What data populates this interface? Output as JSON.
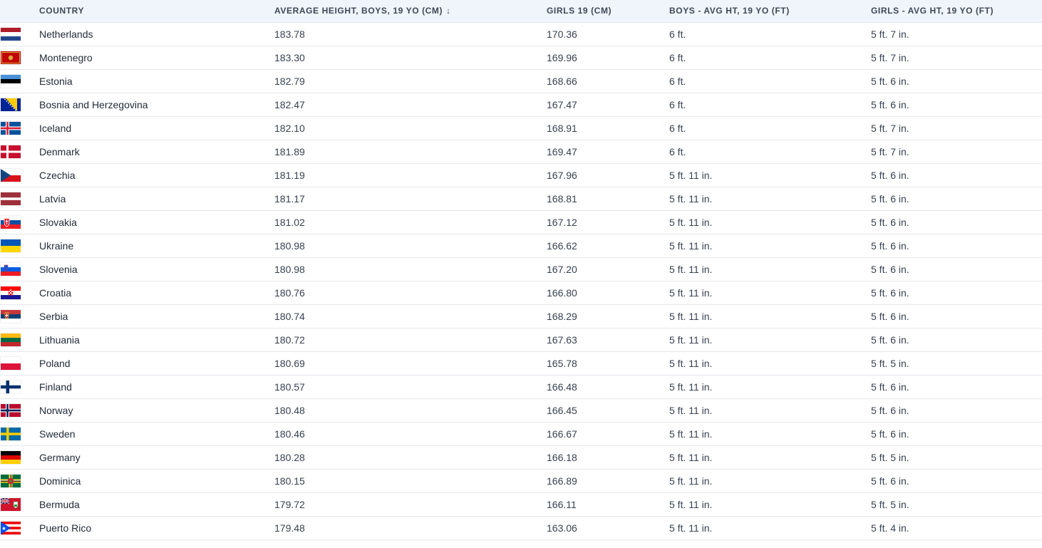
{
  "table": {
    "headers": {
      "country": "COUNTRY",
      "boys_cm": "AVERAGE HEIGHT, BOYS, 19 YO (CM)",
      "boys_cm_sort": "↓",
      "girls_cm": "GIRLS 19 (CM)",
      "boys_ft": "BOYS - AVG HT, 19 YO (FT)",
      "girls_ft": "GIRLS - AVG HT, 19 YO (FT)"
    },
    "rows": [
      {
        "flag": "netherlands-flag-icon",
        "country": "Netherlands",
        "boys_cm": "183.78",
        "girls_cm": "170.36",
        "boys_ft": "6 ft.",
        "girls_ft": "5 ft. 7 in."
      },
      {
        "flag": "montenegro-flag-icon",
        "country": "Montenegro",
        "boys_cm": "183.30",
        "girls_cm": "169.96",
        "boys_ft": "6 ft.",
        "girls_ft": "5 ft. 7 in."
      },
      {
        "flag": "estonia-flag-icon",
        "country": "Estonia",
        "boys_cm": "182.79",
        "girls_cm": "168.66",
        "boys_ft": "6 ft.",
        "girls_ft": "5 ft. 6 in."
      },
      {
        "flag": "bosnia-and-herzegovina-flag-icon",
        "country": "Bosnia and Herzegovina",
        "boys_cm": "182.47",
        "girls_cm": "167.47",
        "boys_ft": "6 ft.",
        "girls_ft": "5 ft. 6 in."
      },
      {
        "flag": "iceland-flag-icon",
        "country": "Iceland",
        "boys_cm": "182.10",
        "girls_cm": "168.91",
        "boys_ft": "6 ft.",
        "girls_ft": "5 ft. 7 in."
      },
      {
        "flag": "denmark-flag-icon",
        "country": "Denmark",
        "boys_cm": "181.89",
        "girls_cm": "169.47",
        "boys_ft": "6 ft.",
        "girls_ft": "5 ft. 7 in."
      },
      {
        "flag": "czechia-flag-icon",
        "country": "Czechia",
        "boys_cm": "181.19",
        "girls_cm": "167.96",
        "boys_ft": "5 ft. 11 in.",
        "girls_ft": "5 ft. 6 in."
      },
      {
        "flag": "latvia-flag-icon",
        "country": "Latvia",
        "boys_cm": "181.17",
        "girls_cm": "168.81",
        "boys_ft": "5 ft. 11 in.",
        "girls_ft": "5 ft. 6 in."
      },
      {
        "flag": "slovakia-flag-icon",
        "country": "Slovakia",
        "boys_cm": "181.02",
        "girls_cm": "167.12",
        "boys_ft": "5 ft. 11 in.",
        "girls_ft": "5 ft. 6 in."
      },
      {
        "flag": "ukraine-flag-icon",
        "country": "Ukraine",
        "boys_cm": "180.98",
        "girls_cm": "166.62",
        "boys_ft": "5 ft. 11 in.",
        "girls_ft": "5 ft. 6 in."
      },
      {
        "flag": "slovenia-flag-icon",
        "country": "Slovenia",
        "boys_cm": "180.98",
        "girls_cm": "167.20",
        "boys_ft": "5 ft. 11 in.",
        "girls_ft": "5 ft. 6 in."
      },
      {
        "flag": "croatia-flag-icon",
        "country": "Croatia",
        "boys_cm": "180.76",
        "girls_cm": "166.80",
        "boys_ft": "5 ft. 11 in.",
        "girls_ft": "5 ft. 6 in."
      },
      {
        "flag": "serbia-flag-icon",
        "country": "Serbia",
        "boys_cm": "180.74",
        "girls_cm": "168.29",
        "boys_ft": "5 ft. 11 in.",
        "girls_ft": "5 ft. 6 in."
      },
      {
        "flag": "lithuania-flag-icon",
        "country": "Lithuania",
        "boys_cm": "180.72",
        "girls_cm": "167.63",
        "boys_ft": "5 ft. 11 in.",
        "girls_ft": "5 ft. 6 in."
      },
      {
        "flag": "poland-flag-icon",
        "country": "Poland",
        "boys_cm": "180.69",
        "girls_cm": "165.78",
        "boys_ft": "5 ft. 11 in.",
        "girls_ft": "5 ft. 5 in."
      },
      {
        "flag": "finland-flag-icon",
        "country": "Finland",
        "boys_cm": "180.57",
        "girls_cm": "166.48",
        "boys_ft": "5 ft. 11 in.",
        "girls_ft": "5 ft. 6 in."
      },
      {
        "flag": "norway-flag-icon",
        "country": "Norway",
        "boys_cm": "180.48",
        "girls_cm": "166.45",
        "boys_ft": "5 ft. 11 in.",
        "girls_ft": "5 ft. 6 in."
      },
      {
        "flag": "sweden-flag-icon",
        "country": "Sweden",
        "boys_cm": "180.46",
        "girls_cm": "166.67",
        "boys_ft": "5 ft. 11 in.",
        "girls_ft": "5 ft. 6 in."
      },
      {
        "flag": "germany-flag-icon",
        "country": "Germany",
        "boys_cm": "180.28",
        "girls_cm": "166.18",
        "boys_ft": "5 ft. 11 in.",
        "girls_ft": "5 ft. 5 in."
      },
      {
        "flag": "dominica-flag-icon",
        "country": "Dominica",
        "boys_cm": "180.15",
        "girls_cm": "166.89",
        "boys_ft": "5 ft. 11 in.",
        "girls_ft": "5 ft. 6 in."
      },
      {
        "flag": "bermuda-flag-icon",
        "country": "Bermuda",
        "boys_cm": "179.72",
        "girls_cm": "166.11",
        "boys_ft": "5 ft. 11 in.",
        "girls_ft": "5 ft. 5 in."
      },
      {
        "flag": "puerto-rico-flag-icon",
        "country": "Puerto Rico",
        "boys_cm": "179.48",
        "girls_cm": "163.06",
        "boys_ft": "5 ft. 11 in.",
        "girls_ft": "5 ft. 4 in."
      }
    ]
  },
  "colors": {
    "header_bg": "#f0f5fb",
    "row_border": "#e5e7eb",
    "text": "#1f2937"
  }
}
